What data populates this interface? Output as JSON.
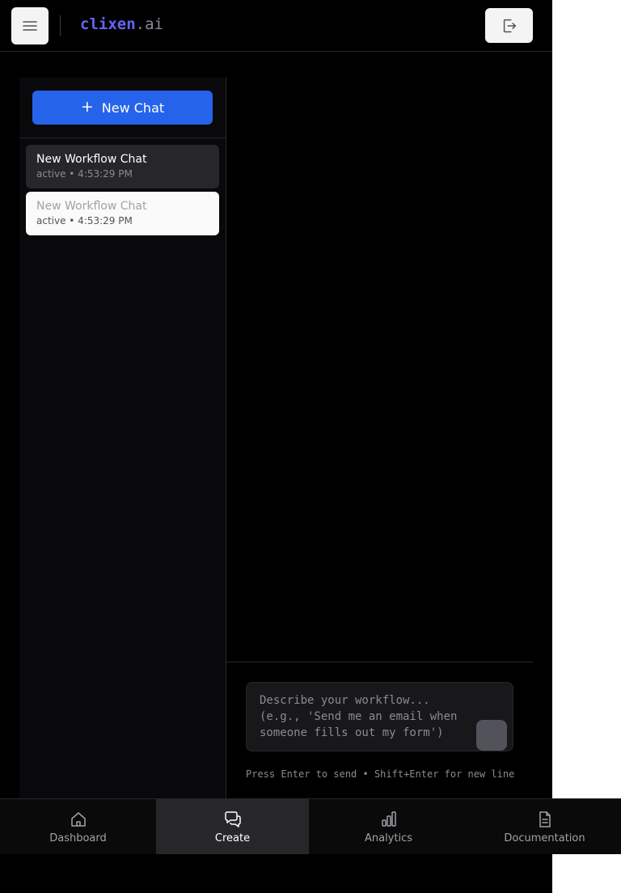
{
  "header": {
    "brand_primary": "clixen",
    "brand_secondary": ".ai",
    "menu_icon": "hamburger-icon",
    "logout_icon": "logout-icon"
  },
  "sidebar": {
    "new_chat_label": "New Chat",
    "new_chat_icon": "plus-icon",
    "chats": [
      {
        "title": "New Workflow Chat",
        "meta": "active • 4:53:29 PM"
      },
      {
        "title": "New Workflow Chat",
        "meta": "active • 4:53:29 PM"
      }
    ]
  },
  "composer": {
    "placeholder": "Describe your workflow...\n(e.g., 'Send me an email when someone fills out my form')",
    "value": "",
    "hint": "Press Enter to send • Shift+Enter for new line"
  },
  "bottom_nav": {
    "items": [
      {
        "label": "Dashboard",
        "icon": "home-icon",
        "active": false
      },
      {
        "label": "Create",
        "icon": "chat-bubbles-icon",
        "active": true
      },
      {
        "label": "Analytics",
        "icon": "bar-chart-icon",
        "active": false
      },
      {
        "label": "Documentation",
        "icon": "document-icon",
        "active": false
      }
    ]
  },
  "colors": {
    "accent": "#2563eb",
    "brand": "#6366f1",
    "background": "#000000"
  }
}
